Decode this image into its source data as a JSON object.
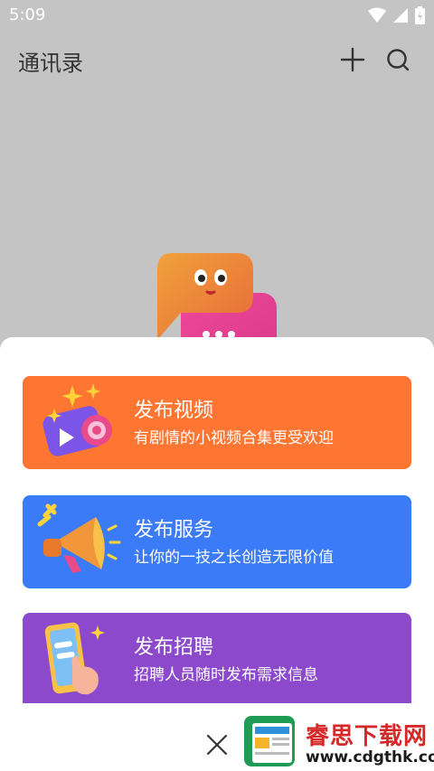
{
  "status_bar": {
    "time": "5:09"
  },
  "app_bar": {
    "title": "通讯录"
  },
  "cards": [
    {
      "title": "发布视频",
      "subtitle": "有剧情的小视频合集更受欢迎",
      "color": "#ff7532",
      "icon": "camera-icon"
    },
    {
      "title": "发布服务",
      "subtitle": "让你的一技之长创造无限价值",
      "color": "#3b7bf7",
      "icon": "megaphone-icon"
    },
    {
      "title": "发布招聘",
      "subtitle": "招聘人员随时发布需求信息",
      "color": "#8c49cc",
      "icon": "phone-hand-icon"
    }
  ],
  "watermark": {
    "title": "睿思下载网",
    "url": "www.cdgthk.com"
  }
}
